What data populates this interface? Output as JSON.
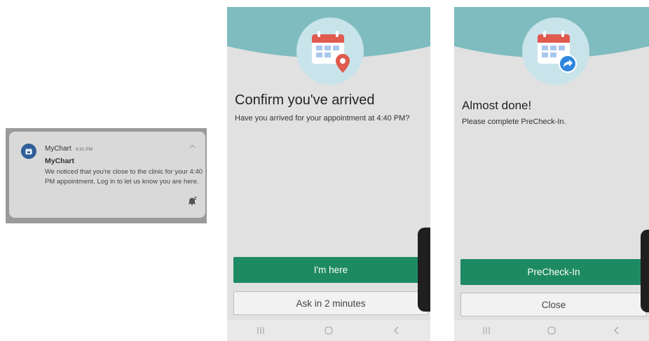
{
  "notification": {
    "app_name": "MyChart",
    "time": "4:31 PM",
    "title": "MyChart",
    "body": "We noticed that you're close to the clinic for your 4:40 PM appointment. Log in to let us know you are here.",
    "icons": [
      "mychart-app-icon",
      "collapse-chevron-icon",
      "snooze-bell-icon"
    ]
  },
  "screen_arrived": {
    "heading": "Confirm you've arrived",
    "subtext": "Have you arrived for your appointment at 4:40 PM?",
    "primary_label": "I'm here",
    "secondary_label": "Ask in 2 minutes",
    "icon": "calendar-location-icon"
  },
  "screen_done": {
    "heading": "Almost done!",
    "subtext": "Please complete PreCheck-In.",
    "primary_label": "PreCheck-In",
    "secondary_label": "Close",
    "icon": "calendar-share-icon"
  },
  "colors": {
    "teal_header": "#7fbcbf",
    "primary_button": "#1e8a63",
    "icon_circle": "#c8e4ea",
    "calendar_red": "#e05a4f",
    "share_blue": "#2f86e0"
  }
}
